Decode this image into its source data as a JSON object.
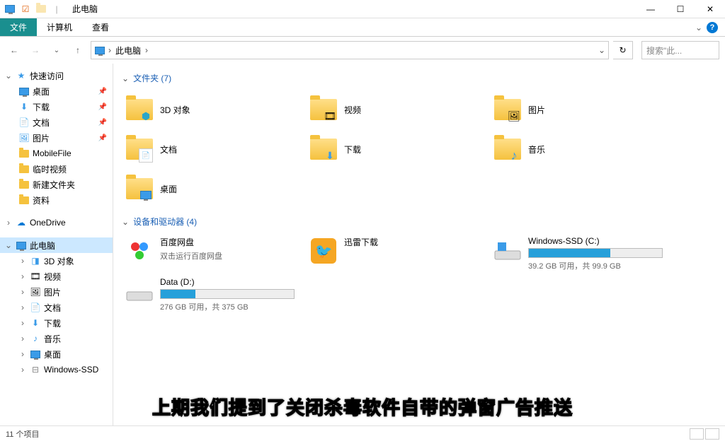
{
  "window": {
    "title": "此电脑",
    "min": "—",
    "max": "☐",
    "close": "✕"
  },
  "ribbon": {
    "file": "文件",
    "computer": "计算机",
    "view": "查看",
    "expand": "⌄",
    "help": "?"
  },
  "nav": {
    "back": "←",
    "forward": "→",
    "recent": "⌄",
    "up": "↑",
    "crumb_root": "此电脑",
    "sep": "›",
    "addr_drop": "⌄",
    "refresh": "↻",
    "search_placeholder": "搜索\"此..."
  },
  "sidebar": {
    "quick": {
      "label": "快速访问",
      "exp": "⌄"
    },
    "quick_items": [
      {
        "label": "桌面",
        "icon": "desktop",
        "pin": true
      },
      {
        "label": "下载",
        "icon": "download",
        "pin": true
      },
      {
        "label": "文档",
        "icon": "doc",
        "pin": true
      },
      {
        "label": "图片",
        "icon": "pic",
        "pin": true
      },
      {
        "label": "MobileFile",
        "icon": "folder"
      },
      {
        "label": "临时视频",
        "icon": "folder"
      },
      {
        "label": "新建文件夹",
        "icon": "folder"
      },
      {
        "label": "资料",
        "icon": "folder"
      }
    ],
    "onedrive": {
      "label": "OneDrive",
      "exp": "›"
    },
    "thispc": {
      "label": "此电脑",
      "exp": "⌄"
    },
    "thispc_items": [
      {
        "label": "3D 对象",
        "exp": "›"
      },
      {
        "label": "视频",
        "exp": "›"
      },
      {
        "label": "图片",
        "exp": "›"
      },
      {
        "label": "文档",
        "exp": "›"
      },
      {
        "label": "下载",
        "exp": "›"
      },
      {
        "label": "音乐",
        "exp": "›"
      },
      {
        "label": "桌面",
        "exp": "›"
      },
      {
        "label": "Windows-SSD",
        "exp": "›"
      }
    ]
  },
  "content": {
    "section_folders": "文件夹 (7)",
    "section_drives": "设备和驱动器 (4)",
    "caret": "⌄",
    "folders": [
      {
        "label": "3D 对象",
        "overlay": "3d"
      },
      {
        "label": "视频",
        "overlay": "video"
      },
      {
        "label": "图片",
        "overlay": "pic"
      },
      {
        "label": "文档",
        "overlay": "doc"
      },
      {
        "label": "下载",
        "overlay": "download"
      },
      {
        "label": "音乐",
        "overlay": "music"
      },
      {
        "label": "桌面",
        "overlay": "desktop"
      }
    ],
    "drives": [
      {
        "label": "百度网盘",
        "sub": "双击运行百度网盘",
        "icon": "baidu"
      },
      {
        "label": "迅雷下载",
        "sub": "",
        "icon": "xunlei"
      },
      {
        "label": "Windows-SSD (C:)",
        "sub": "39.2 GB 可用，共 99.9 GB",
        "icon": "drive",
        "fill": 61
      },
      {
        "label": "Data (D:)",
        "sub": "276 GB 可用，共 375 GB",
        "icon": "drive",
        "fill": 26
      }
    ]
  },
  "status": {
    "count": "11 个项目"
  },
  "subtitle": "上期我们提到了关闭杀毒软件自带的弹窗广告推送"
}
